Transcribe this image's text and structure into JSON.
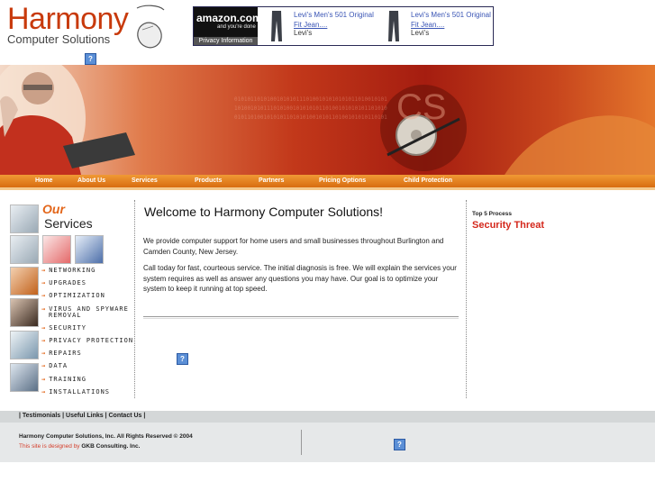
{
  "logo": {
    "title": "Harmony",
    "subtitle": "Computer Solutions"
  },
  "ad": {
    "amazon_logo": "amazon.com",
    "amazon_tag": "and you're done",
    "privacy": "Privacy Information",
    "products": [
      {
        "title_line1": "Levi's Men's 501 Original",
        "title_line2": "Fit Jean....",
        "brand": "Levi's"
      },
      {
        "title_line1": "Levi's Men's 501 Original",
        "title_line2": "Fit Jean....",
        "brand": "Levi's"
      }
    ]
  },
  "help_icon": "?",
  "nav": {
    "items": [
      "Home",
      "About Us",
      "Services",
      "Products",
      "Partners",
      "Pricing Options",
      "Child Protection"
    ]
  },
  "services": {
    "heading_our": "Our",
    "heading_services": "Services",
    "items": [
      "NETWORKING",
      "UPGRADES",
      "OPTIMIZATION",
      "VIRUS AND SPYWARE",
      "REMOVAL",
      "SECURITY",
      "PRIVACY PROTECTION",
      "REPAIRS",
      "DATA",
      "TRAINING",
      "INSTALLATIONS"
    ],
    "arrow": "→"
  },
  "main": {
    "welcome": "Welcome to Harmony Computer Solutions!",
    "para1": "We provide computer support for home users and small businesses throughout Burlington and Camden County, New Jersey.",
    "para2": "Call today for fast, courteous service. The initial diagnosis is free. We will explain the services your system requires as well as answer any questions you may have. Our goal is to optimize your system to keep it running at top speed."
  },
  "sidebar_right": {
    "top5": "Top 5 Process",
    "threat": "Security Threat"
  },
  "footer": {
    "links": "| Testimonials  | Useful Links  | Contact Us |",
    "copyright": "Harmony Computer Solutions, Inc. All Rights Reserved © 2004",
    "designed_prefix": "This site is designed by",
    "designed_by": "GKB Consulting. Inc."
  }
}
